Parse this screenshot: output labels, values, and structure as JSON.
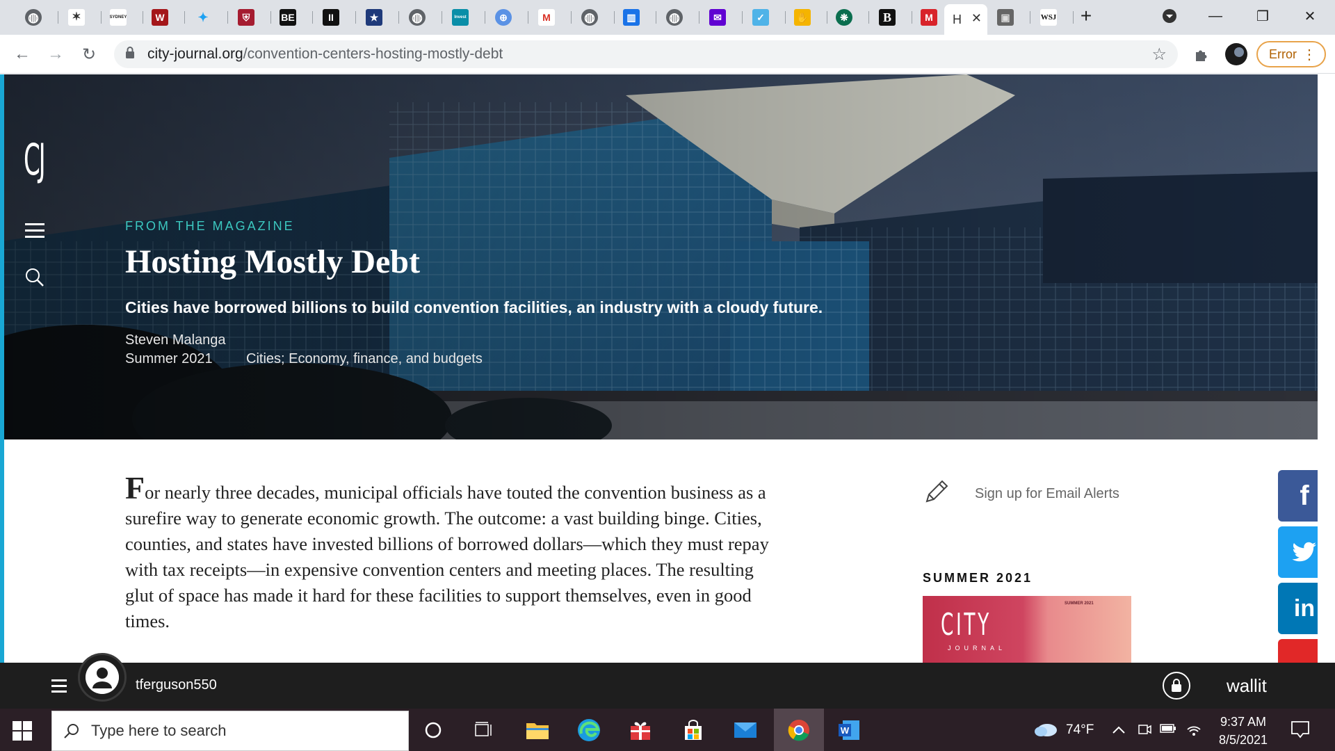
{
  "browser": {
    "active_tab_label": "H",
    "tabs": [
      {
        "icon": "globe-icon"
      },
      {
        "icon": "stars-icon"
      },
      {
        "icon": "sydney-icon",
        "text": "SYDNEY"
      },
      {
        "icon": "w-icon",
        "text": "W"
      },
      {
        "icon": "twitter-icon"
      },
      {
        "icon": "shield-crest-icon"
      },
      {
        "icon": "be-icon",
        "text": "BE"
      },
      {
        "icon": "ii-icon",
        "text": "II"
      },
      {
        "icon": "star-flag-icon"
      },
      {
        "icon": "globe-icon"
      },
      {
        "icon": "invest-icon",
        "text": "Invest"
      },
      {
        "icon": "un-icon"
      },
      {
        "icon": "gmail-icon",
        "text": "M"
      },
      {
        "icon": "globe-icon"
      },
      {
        "icon": "chart-icon"
      },
      {
        "icon": "globe-icon"
      },
      {
        "icon": "mail-purple-icon"
      },
      {
        "icon": "shield-check-icon"
      },
      {
        "icon": "hand-icon"
      },
      {
        "icon": "palm-icon"
      },
      {
        "icon": "b-icon",
        "text": "B"
      },
      {
        "icon": "m-red-icon",
        "text": "M"
      },
      {
        "icon": "active"
      },
      {
        "icon": "portrait-icon"
      },
      {
        "icon": "wsj-icon",
        "text": "WSJ"
      }
    ],
    "url_domain": "city-journal.org",
    "url_path": "/convention-centers-hosting-mostly-debt",
    "error_label": "Error"
  },
  "article": {
    "kicker": "FROM THE MAGAZINE",
    "title": "Hosting Mostly Debt",
    "subtitle": "Cities have borrowed billions to build convention facilities, an industry with a cloudy future.",
    "author": "Steven Malanga",
    "issue": "Summer 2021",
    "topics": "Cities; Economy, finance, and budgets",
    "dropcap": "F",
    "body": "or nearly three decades, municipal officials have touted the convention business as a surefire way to generate economic growth. The outcome: a vast building binge. Cities, counties, and states have invested billions of borrowed dollars—which they must repay with tax receipts—in expensive convention centers and meeting places. The resulting glut of space has made it hard for these facilities to support themselves, even in good times."
  },
  "site": {
    "logo": "CJ"
  },
  "sidebar": {
    "signup_label": "Sign up for Email Alerts",
    "issue_label": "SUMMER 2021",
    "cover_title": "CITY",
    "cover_sub": "JOURNAL",
    "cover_issue": "SUMMER 2021"
  },
  "share": {
    "facebook": {
      "label": "f",
      "color": "#3b5998"
    },
    "twitter": {
      "color": "#1da1f2"
    },
    "linkedin": {
      "label": "in",
      "color": "#0077b5"
    },
    "flipboard": {
      "color": "#e12828"
    }
  },
  "wallit": {
    "username": "tferguson550",
    "brand": "wallit"
  },
  "taskbar": {
    "search_placeholder": "Type here to search",
    "temperature": "74°F",
    "time": "9:37 AM",
    "date": "8/5/2021"
  }
}
